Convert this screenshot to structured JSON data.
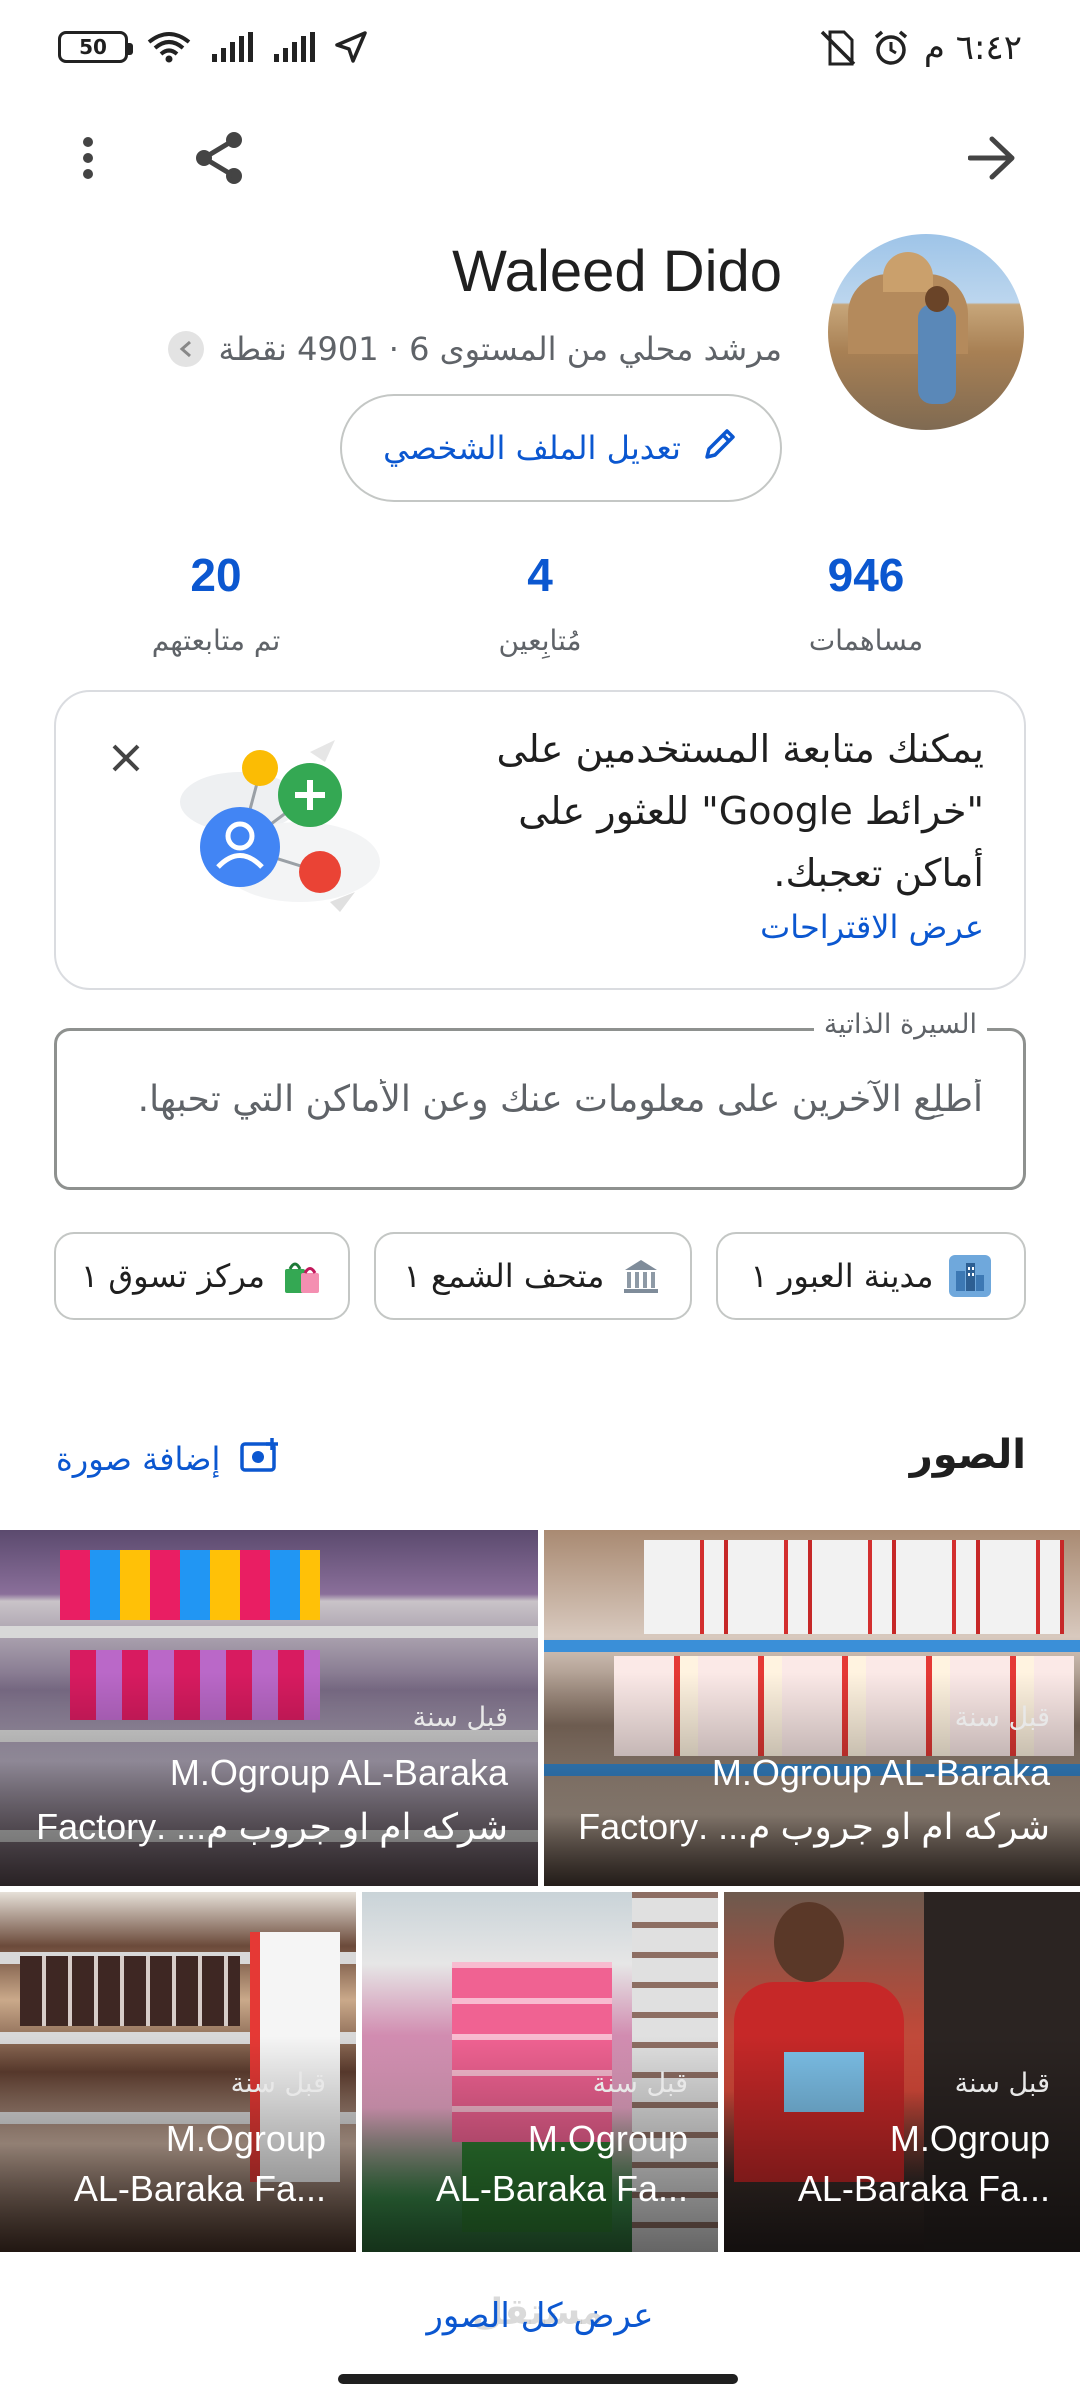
{
  "status_bar": {
    "battery": "50",
    "time": "٦:٤٢ م",
    "icons": [
      "wifi-icon",
      "signal-icon",
      "signal-icon",
      "location-arrow-icon",
      "alarm-icon",
      "no-sim-icon"
    ]
  },
  "profile": {
    "name": "Waleed Dido",
    "level_line": "مرشد محلي من المستوى 6 · 4901 نقطة",
    "edit_label": "تعديل الملف الشخصي"
  },
  "stats": [
    {
      "value": "946",
      "label": "مساهمات"
    },
    {
      "value": "4",
      "label": "مُتابِعين"
    },
    {
      "value": "20",
      "label": "تم متابعتهم"
    }
  ],
  "suggestion_card": {
    "text": "يمكنك متابعة المستخدمين على \"خرائط Google\" للعثور على أماكن تعجبك.",
    "link": "عرض الاقتراحات"
  },
  "bio": {
    "label": "السيرة الذاتية",
    "placeholder": "أطلِع الآخرين على معلومات عنك وعن الأماكن التي تحبها."
  },
  "chips": [
    {
      "label": "مدينة العبور ١",
      "icon": "city-icon"
    },
    {
      "label": "متحف الشمع ١",
      "icon": "museum-icon"
    },
    {
      "label": "مركز تسوق ١",
      "icon": "shopping-bags-icon"
    }
  ],
  "photos": {
    "title": "الصور",
    "add_label": "إضافة صورة",
    "items": [
      {
        "ago": "قبل سنة",
        "title": "M.Ogroup AL-Baraka",
        "subtitle": "شركه ام او جروب م... .Factory"
      },
      {
        "ago": "قبل سنة",
        "title": "M.Ogroup AL-Baraka",
        "subtitle": "شركه ام او جروب م... .Factory"
      },
      {
        "ago": "قبل سنة",
        "title": "M.Ogroup",
        "subtitle": "AL-Baraka Fa..."
      },
      {
        "ago": "قبل سنة",
        "title": "M.Ogroup",
        "subtitle": "AL-Baraka Fa..."
      },
      {
        "ago": "قبل سنة",
        "title": "M.Ogroup",
        "subtitle": "AL-Baraka Fa..."
      }
    ],
    "view_all": "عرض كل الصور"
  },
  "watermark": "مستقل",
  "colors": {
    "accent": "#0b57d0",
    "text": "#1f1f1f",
    "muted": "#5f6368"
  }
}
